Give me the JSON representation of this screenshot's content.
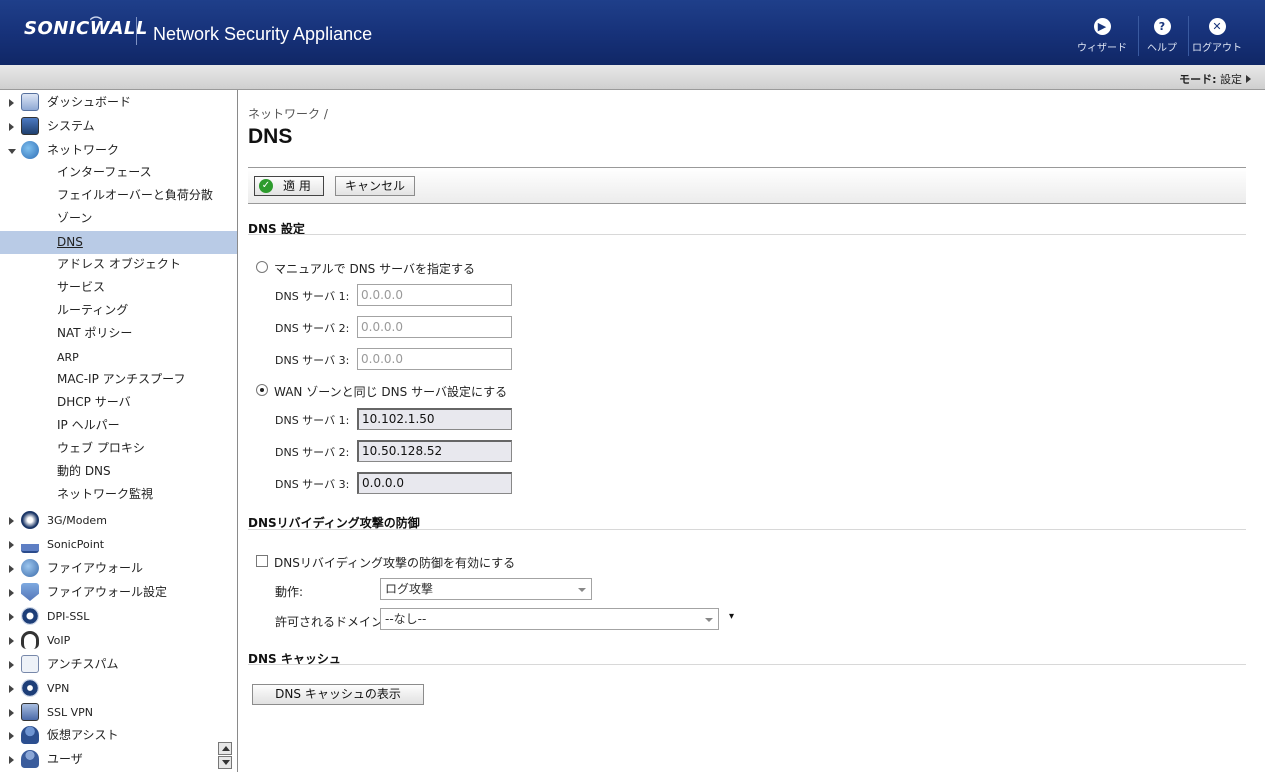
{
  "header": {
    "logo": "SONICWALL",
    "app_title": "Network Security Appliance",
    "buttons": [
      {
        "label": "ウィザード",
        "icon": "wizard-icon"
      },
      {
        "label": "ヘルプ",
        "icon": "help-icon"
      },
      {
        "label": "ログアウト",
        "icon": "logout-icon"
      }
    ]
  },
  "modebar": {
    "prefix": "モード:",
    "value": "設定"
  },
  "sidebar": {
    "top_items": [
      {
        "label": "ダッシュボード",
        "icon": "dashboard-icon"
      },
      {
        "label": "システム",
        "icon": "system-icon"
      },
      {
        "label": "ネットワーク",
        "icon": "network-icon"
      }
    ],
    "network_sub": [
      "インターフェース",
      "フェイルオーバーと負荷分散",
      "ゾーン",
      "DNS",
      "アドレス オブジェクト",
      "サービス",
      "ルーティング",
      "NAT ポリシー",
      "ARP",
      "MAC-IP アンチスプーフ",
      "DHCP サーバ",
      "IP ヘルパー",
      "ウェブ プロキシ",
      "動的 DNS",
      "ネットワーク監視"
    ],
    "bottom_items": [
      {
        "label": "3G/Modem",
        "icon": "modem-icon"
      },
      {
        "label": "SonicPoint",
        "icon": "sonicpoint-icon"
      },
      {
        "label": "ファイアウォール",
        "icon": "firewall-icon"
      },
      {
        "label": "ファイアウォール設定",
        "icon": "firewall-settings-icon"
      },
      {
        "label": "DPI-SSL",
        "icon": "dpi-ssl-icon"
      },
      {
        "label": "VoIP",
        "icon": "voip-icon"
      },
      {
        "label": "アンチスパム",
        "icon": "antispam-icon"
      },
      {
        "label": "VPN",
        "icon": "vpn-icon"
      },
      {
        "label": "SSL VPN",
        "icon": "ssl-vpn-icon"
      },
      {
        "label": "仮想アシスト",
        "icon": "virtual-assist-icon"
      },
      {
        "label": "ユーザ",
        "icon": "users-icon"
      }
    ]
  },
  "main": {
    "breadcrumb": "ネットワーク /",
    "title": "DNS",
    "toolbar": {
      "apply": "適 用",
      "cancel": "キャンセル"
    },
    "dns_settings": {
      "title": "DNS 設定",
      "manual_label": "マニュアルで DNS サーバを指定する",
      "manual_servers": [
        {
          "label": "DNS サーバ 1:",
          "placeholder": "0.0.0.0"
        },
        {
          "label": "DNS サーバ 2:",
          "placeholder": "0.0.0.0"
        },
        {
          "label": "DNS サーバ 3:",
          "placeholder": "0.0.0.0"
        }
      ],
      "wan_label": "WAN ゾーンと同じ DNS サーバ設定にする",
      "wan_servers": [
        {
          "label": "DNS サーバ 1:",
          "value": "10.102.1.50"
        },
        {
          "label": "DNS サーバ 2:",
          "value": "10.50.128.52"
        },
        {
          "label": "DNS サーバ 3:",
          "value": "0.0.0.0"
        }
      ]
    },
    "rebinding": {
      "title": "DNSリバイディング攻撃の防御",
      "enable_label": "DNSリバイディング攻撃の防御を有効にする",
      "action_label": "動作:",
      "action_value": "ログ攻撃",
      "domains_label": "許可されるドメイン:",
      "domains_value": "--なし--"
    },
    "cache": {
      "title": "DNS キャッシュ",
      "button": "DNS キャッシュの表示"
    }
  }
}
